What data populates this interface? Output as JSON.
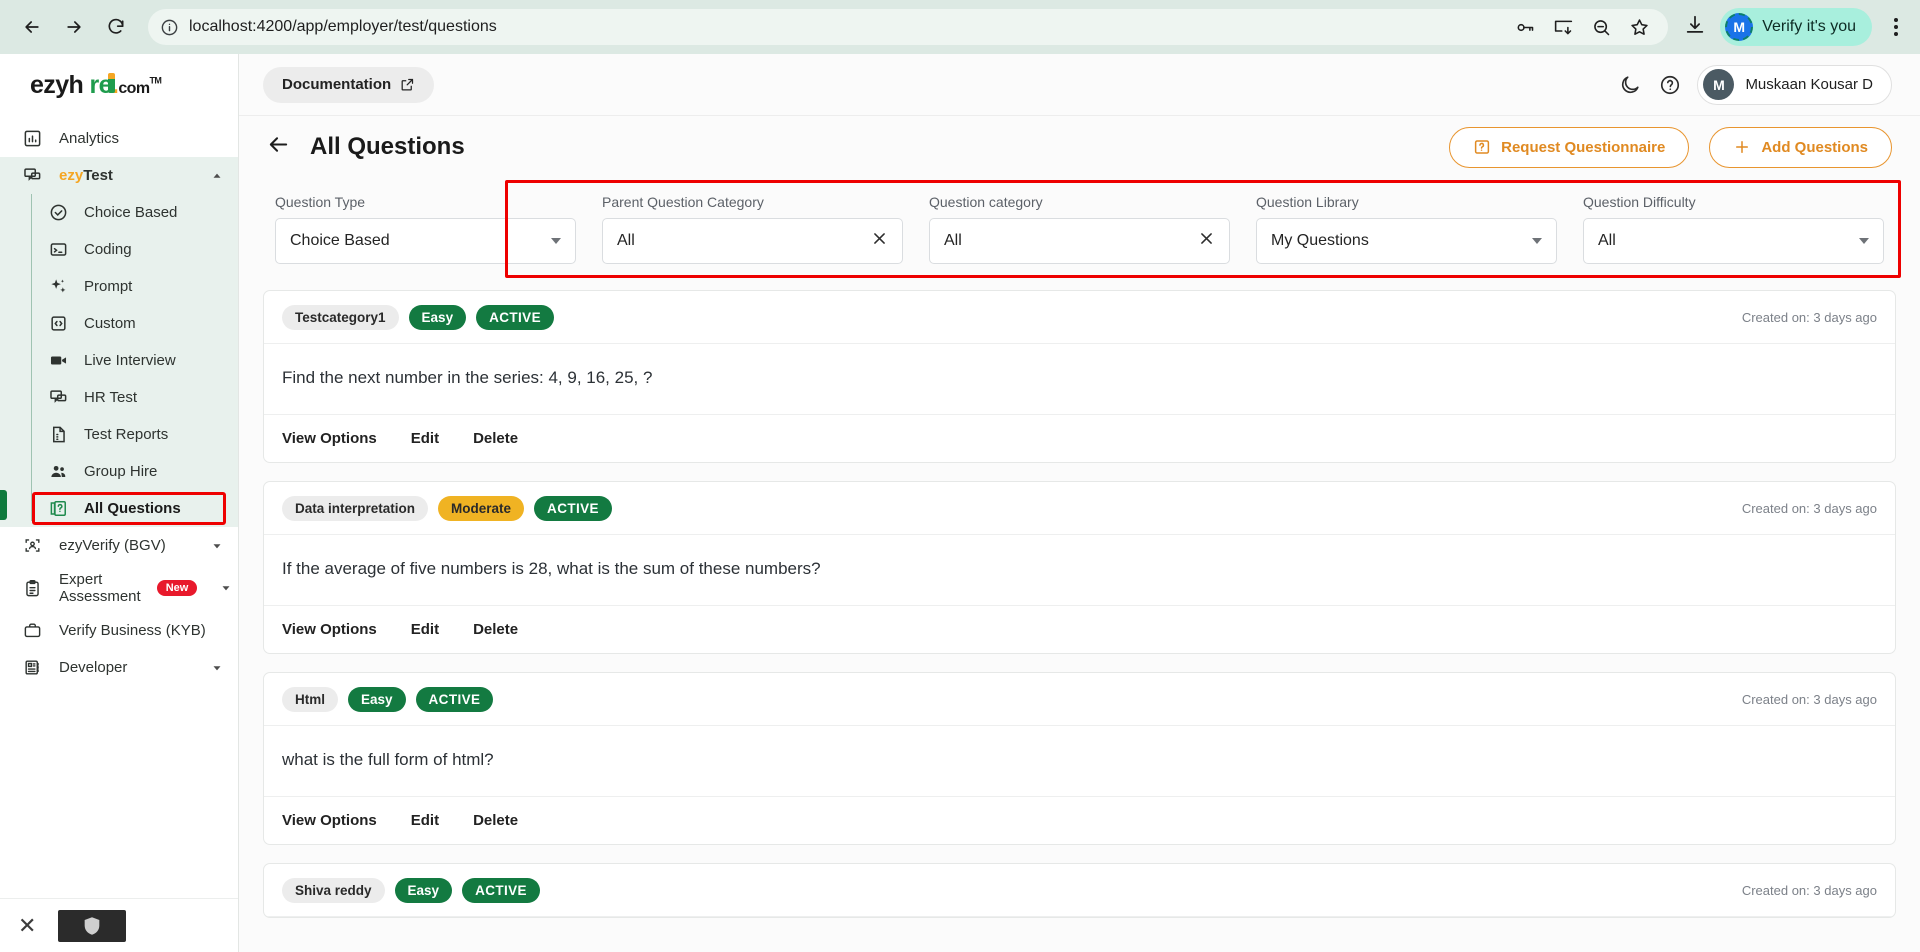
{
  "browser": {
    "url": "localhost:4200/app/employer/test/questions",
    "back_label": "Back",
    "forward_label": "Forward",
    "reload_label": "Reload",
    "site_info_label": "View site information",
    "passwords_label": "Passwords",
    "install_label": "Install page as app",
    "zoom_label": "Zoom out",
    "bookmark_label": "Bookmark this tab",
    "download_label": "Downloads",
    "verify_text": "Verify it's you",
    "verify_avatar": "M",
    "menu_label": "Customize and control Chrome"
  },
  "sidebar": {
    "logo": {
      "part1": "ezyh",
      "pin": "i",
      "part2": "re",
      "dot": ".",
      "com": "com",
      "tm": "TM"
    },
    "items": [
      {
        "label": "Analytics",
        "icon": "analytics-icon",
        "type": "item"
      },
      {
        "label": "ezyTest",
        "icon": "ezytest-icon",
        "type": "group",
        "expanded": true,
        "prefix": "ezy",
        "suffix": "Test"
      },
      {
        "label": "ezyVerify (BGV)",
        "icon": "face-scan-icon",
        "type": "group",
        "expanded": false
      },
      {
        "label": "Expert Assessment",
        "icon": "clipboard-icon",
        "type": "group",
        "expanded": false,
        "badge": "New"
      },
      {
        "label": "Verify Business (KYB)",
        "icon": "briefcase-icon",
        "type": "item"
      },
      {
        "label": "Developer",
        "icon": "developer-icon",
        "type": "group",
        "expanded": false
      }
    ],
    "subitems": [
      {
        "label": "Choice Based",
        "icon": "check-circle-icon",
        "active": false
      },
      {
        "label": "Coding",
        "icon": "terminal-icon",
        "active": false
      },
      {
        "label": "Prompt",
        "icon": "sparkle-icon",
        "active": false
      },
      {
        "label": "Custom",
        "icon": "code-clipboard-icon",
        "active": false
      },
      {
        "label": "Live Interview",
        "icon": "video-camera-icon",
        "active": false
      },
      {
        "label": "HR Test",
        "icon": "chat-icon",
        "active": false
      },
      {
        "label": "Test Reports",
        "icon": "report-icon",
        "active": false
      },
      {
        "label": "Group Hire",
        "icon": "group-icon",
        "active": false
      },
      {
        "label": "All Questions",
        "icon": "question-doc-icon",
        "active": true
      }
    ]
  },
  "topbar": {
    "documentation_label": "Documentation",
    "dark_mode_label": "Dark mode",
    "help_label": "Help",
    "user_initial": "M",
    "user_name": "Muskaan Kousar D"
  },
  "page": {
    "title": "All Questions",
    "back_label": "Back",
    "request_questionnaire": "Request Questionnaire",
    "add_questions": "Add Questions"
  },
  "filters": [
    {
      "label": "Question Type",
      "value": "Choice Based",
      "control": "dropdown"
    },
    {
      "label": "Parent Question Category",
      "value": "All",
      "control": "clearable"
    },
    {
      "label": "Question category",
      "value": "All",
      "control": "clearable"
    },
    {
      "label": "Question Library",
      "value": "My Questions",
      "control": "dropdown"
    },
    {
      "label": "Question Difficulty",
      "value": "All",
      "control": "dropdown"
    }
  ],
  "question_actions": {
    "view_options": "View Options",
    "edit": "Edit",
    "delete": "Delete"
  },
  "questions": [
    {
      "category": "Testcategory1",
      "difficulty": "Easy",
      "difficulty_style": "easy",
      "status": "ACTIVE",
      "created": "Created on: 3 days ago",
      "text": "Find the next number in the series: 4, 9, 16, 25, ?"
    },
    {
      "category": "Data interpretation",
      "difficulty": "Moderate",
      "difficulty_style": "moderate",
      "status": "ACTIVE",
      "created": "Created on: 3 days ago",
      "text": "If the average of five numbers is 28, what is the sum of these numbers?"
    },
    {
      "category": "Html",
      "difficulty": "Easy",
      "difficulty_style": "easy",
      "status": "ACTIVE",
      "created": "Created on: 3 days ago",
      "text": "what is the full form of html?"
    },
    {
      "category": "Shiva reddy",
      "difficulty": "Easy",
      "difficulty_style": "easy",
      "status": "ACTIVE",
      "created": "Created on: 3 days ago",
      "text": ""
    }
  ],
  "colors": {
    "accent_orange": "#e08a22",
    "green": "#137a41",
    "yellow": "#f0b323",
    "annotation_red": "#ee0000",
    "sidebar_active_bg": "#e8f1ed"
  }
}
